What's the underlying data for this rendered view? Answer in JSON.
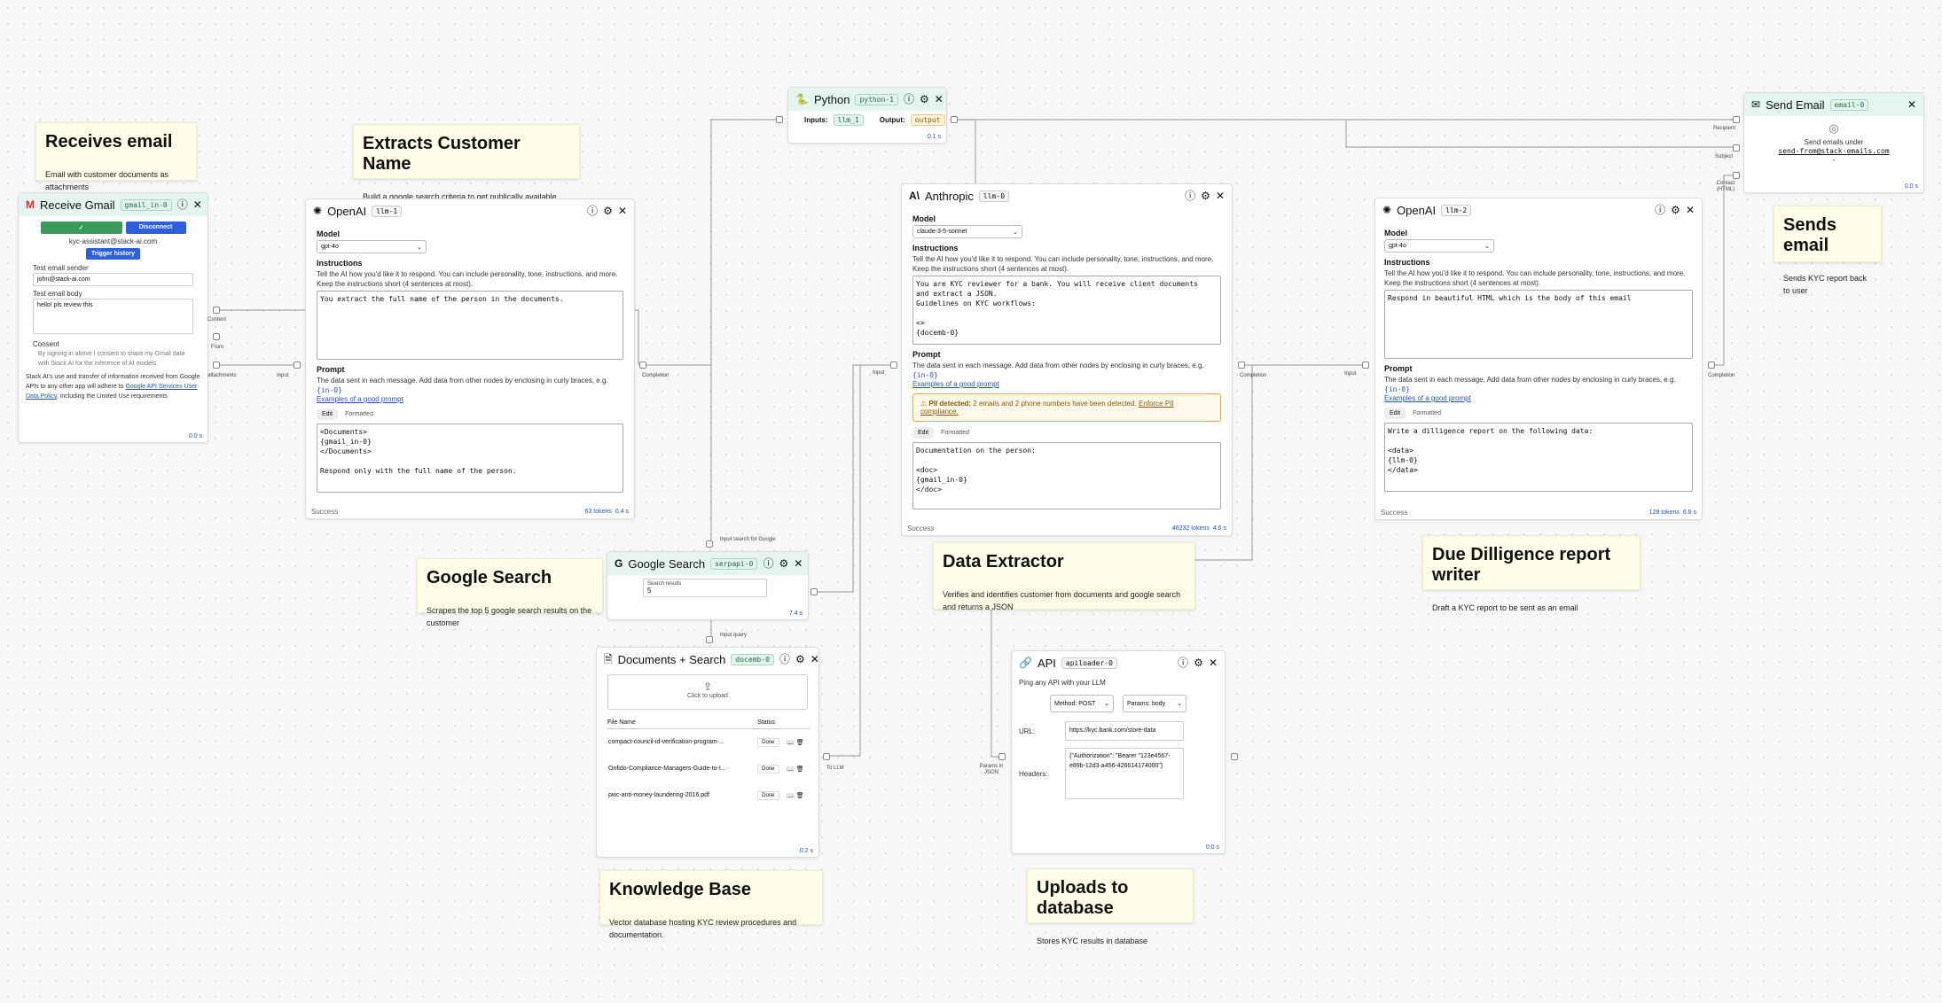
{
  "colors": {
    "accent": "#2b5fe0",
    "teal_header": "#e4f4f0",
    "sticky": "#fdfde8",
    "edge": "#a0a0a0",
    "success_green": "#3a9a5c",
    "warning": "#f5a623"
  },
  "stickies": {
    "receives_email": {
      "title": "Receives email",
      "body": "Email with customer documents as attachments"
    },
    "extracts_name": {
      "title": "Extracts Customer Name",
      "body": "Build a google search criteria to get publically available customer data"
    },
    "google_search": {
      "title": "Google Search",
      "body": "Scrapes the top 5 google search results on the customer"
    },
    "data_extractor": {
      "title": "Data Extractor",
      "body": "Verifies and identifies customer from documents and google search and returns a JSON"
    },
    "due_diligence": {
      "title": "Due Dilligence report writer",
      "body": "Draft a KYC report to be sent as an email"
    },
    "sends_email": {
      "title": "Sends email",
      "body": "Sends KYC report back to user"
    },
    "knowledge_base": {
      "title": "Knowledge Base",
      "body": "Vector database hosting KYC review procedures and documentation."
    },
    "uploads_db": {
      "title": "Uploads to database",
      "body": "Stores KYC results in database"
    }
  },
  "gmail": {
    "title": "Receive Gmail",
    "tag": "gmail_in-0",
    "icon": "gmail-icon",
    "connected_icon": "check-circle-icon",
    "disconnect_label": "Disconnect",
    "account": "kyc-assistant@stack-ai.com",
    "trigger_label": "Trigger history",
    "sender_label": "Test email sender",
    "sender_value": "john@stack-ai.com",
    "body_label": "Test email body",
    "body_value": "hello! pls review this",
    "consent_label": "Consent",
    "consent_text": "By signing in above I consent to share my Gmail data with Stack AI for the inference of AI models.",
    "policy_pre": "Stack AI's use and transfer of information received from Google APIs to any other app will adhere to",
    "policy_link": "Google API Services User Data Policy",
    "policy_post": ", including the Limited Use requirements",
    "time": "0.0 s",
    "ports": {
      "content": "Content",
      "from": "From",
      "attachments": "attachments"
    }
  },
  "openai1": {
    "title": "OpenAI",
    "tag": "llm-1",
    "model_label": "Model",
    "model_value": "gpt-4o",
    "instructions_label": "Instructions",
    "instructions_help": "Tell the AI how you'd like it to respond. You can include personality, tone, instructions, and more. Keep the instructions short (4 sentences at most).",
    "instructions_value": "You extract the full name of the person in the documents.",
    "prompt_label": "Prompt",
    "prompt_help": "The data sent in each message. Add data from other nodes by enclosing in curly braces, e.g.",
    "prompt_example": "{in-0}",
    "examples_link": "Examples of a good prompt",
    "tab_edit": "Edit",
    "tab_formatted": "Formatted",
    "prompt_value": "<Documents>\n{gmail_in-0}\n</Documents>\n\nRespond only with the full name of the person.",
    "status": "Success",
    "tokens": "63 tokens",
    "time": "0.4 s",
    "port_in": "Input",
    "port_out": "Completion"
  },
  "python": {
    "title": "Python",
    "tag": "python-1",
    "inputs_label": "Inputs:",
    "inputs_tag": "llm_1",
    "output_label": "Output:",
    "output_tag": "output",
    "time": "0.1 s"
  },
  "anthropic": {
    "title": "Anthropic",
    "tag": "llm-0",
    "model_label": "Model",
    "model_value": "claude-3-5-sonnet",
    "instructions_label": "Instructions",
    "instructions_help": "Tell the AI how you'd like it to respond. You can include personality, tone, instructions, and more. Keep the instructions short (4 sentences at most).",
    "instructions_value": "You are KYC reviewer for a bank. You will receive client documents\nand extract a JSON.\nGuidelines on KYC workflows:\n\n<>\n{docemb-0}",
    "prompt_label": "Prompt",
    "prompt_help": "The data sent in each message. Add data from other nodes by enclosing in curly braces, e.g.",
    "prompt_example": "{in-0}",
    "examples_link": "Examples of a good prompt",
    "pii_label": "PII detected:",
    "pii_text": "2 emails and 2 phone numbers have been detected.",
    "pii_link": "Enforce PII compliance.",
    "tab_edit": "Edit",
    "tab_formatted": "Formatted",
    "prompt_value": "Documentation on the person:\n\n<doc>\n{gmail_in-0}\n</doc>",
    "status": "Success",
    "tokens": "46232 tokens",
    "time": "4.6 s",
    "port_in": "Input",
    "port_out": "Completion"
  },
  "openai2": {
    "title": "OpenAI",
    "tag": "llm-2",
    "model_label": "Model",
    "model_value": "gpt-4o",
    "instructions_label": "Instructions",
    "instructions_help": "Tell the AI how you'd like it to respond. You can include personality, tone, instructions, and more. Keep the instructions short (4 sentences at most).",
    "instructions_value": "Respond in beautiful HTML which is the body of this email",
    "prompt_label": "Prompt",
    "prompt_help": "The data sent in each message. Add data from other nodes by enclosing in curly braces, e.g.",
    "prompt_example": "{in-0}",
    "examples_link": "Examples of a good prompt",
    "tab_edit": "Edit",
    "tab_formatted": "Formatted",
    "prompt_value": "Write a dilligence report on the following data:\n\n<data>\n{llm-0}\n</data>",
    "status": "Success",
    "tokens": "128 tokens",
    "time": "6.6 s",
    "port_in": "Input",
    "port_out": "Completion"
  },
  "sendemail": {
    "title": "Send Email",
    "tag": "email-0",
    "line1": "Send emails under",
    "address": "send-from@stack-emails.com",
    "dash": "-",
    "time": "0.0 s",
    "ports": {
      "recipient": "Recipient",
      "subject": "Subject",
      "contact": "Contact (HTML)"
    }
  },
  "gsearch": {
    "title": "Google Search",
    "tag": "serpapi-0",
    "field_label": "Search results",
    "field_value": "5",
    "time": "7.4 s",
    "port_top": "Input search for Google",
    "port_bottom": "Input query"
  },
  "docs": {
    "title": "Documents + Search",
    "tag": "docemb-0",
    "upload_label": "Click to upload",
    "col_file": "File Name",
    "col_status": "Status",
    "rows": [
      {
        "file": "compact-council-id-verification-program-...",
        "status": "Done"
      },
      {
        "file": "Onfido-Compliance-Managers-Guide-to-I...",
        "status": "Done"
      },
      {
        "file": "pwc-anti-money-laundering-2016.pdf",
        "status": "Done"
      }
    ],
    "time": "0.2 s",
    "port_out": "To LLM"
  },
  "api": {
    "title": "API",
    "tag": "apiloader-0",
    "desc": "Ping any API with your LLM",
    "method": "Method: POST",
    "params": "Params: body",
    "url_label": "URL:",
    "url_value": "https://kyc.bank.com/store-data",
    "headers_label": "Headers:",
    "headers_value": "{\"Authorization\": \"Bearer \"123e4567-e89b-12d3-a456-426614174000\"}",
    "time": "0.0 s",
    "port_in": "Params in JSON"
  }
}
